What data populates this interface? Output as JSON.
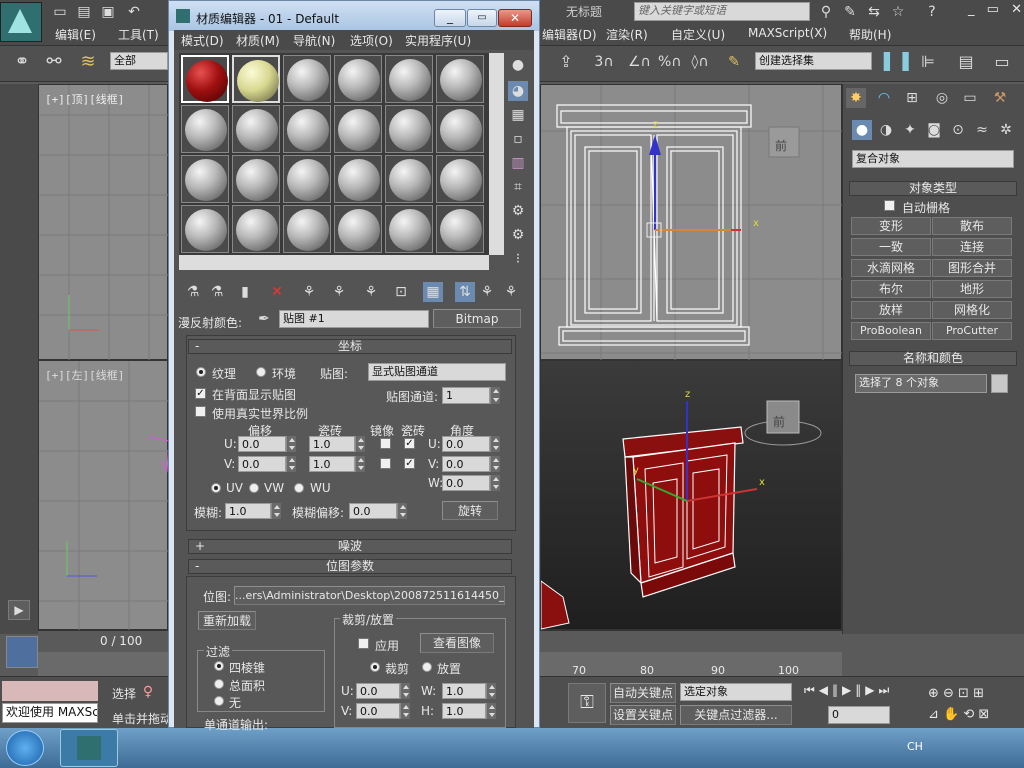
{
  "max_menu": [
    "编辑(E)",
    "工具(T)"
  ],
  "max_menu_right": [
    "编辑器(D)",
    "渲染(R)",
    "自定义(U)",
    "MAXScript(X)",
    "帮助(H)"
  ],
  "max_title": "无标题",
  "search_placeholder": "键入关键字或短语",
  "toolbar": {
    "all_label": "全部",
    "selection_set": "创建选择集"
  },
  "viewports": {
    "top": "[+][顶][线框]",
    "left": "[+][左][线框]",
    "front_cube": "前",
    "persp_cube": "前",
    "axis_x": "x",
    "axis_y": "y",
    "axis_z": "z"
  },
  "command_panel": {
    "dropdown": "复合对象",
    "object_type_header": "对象类型",
    "auto_grid": "自动栅格",
    "buttons": [
      "变形",
      "散布",
      "一致",
      "连接",
      "水滴网格",
      "图形合并",
      "布尔",
      "地形",
      "放样",
      "网格化",
      "ProBoolean",
      "ProCutter"
    ],
    "name_color_header": "名称和颜色",
    "name_value": "选择了 8 个对象"
  },
  "mat_editor": {
    "title": "材质编辑器 - 01 - Default",
    "menu": [
      "模式(D)",
      "材质(M)",
      "导航(N)",
      "选项(O)",
      "实用程序(U)"
    ],
    "diffuse_label": "漫反射颜色:",
    "map_name": "贴图 #1",
    "map_type": "Bitmap",
    "coords": {
      "header": "坐标",
      "texture": "纹理",
      "environ": "环境",
      "mapping_label": "贴图:",
      "mapping_value": "显式贴图通道",
      "show_back": "在背面显示贴图",
      "map_channel_label": "贴图通道:",
      "map_channel": "1",
      "real_world": "使用真实世界比例",
      "offset": "偏移",
      "tiling": "瓷砖",
      "mirror": "镜像",
      "tile": "瓷砖",
      "angle": "角度",
      "u": "U:",
      "v": "V:",
      "w": "W:",
      "u_offset": "0.0",
      "v_offset": "0.0",
      "u_tiling": "1.0",
      "v_tiling": "1.0",
      "u_angle": "0.0",
      "v_angle": "0.0",
      "w_angle": "0.0",
      "uv": "UV",
      "vw": "VW",
      "wu": "WU",
      "blur_label": "模糊:",
      "blur": "1.0",
      "blur_offset_label": "模糊偏移:",
      "blur_offset": "0.0",
      "rotate": "旋转"
    },
    "noise_header": "噪波",
    "bitmap_header": "位图参数",
    "bitmap_label": "位图:",
    "bitmap_path": "...ers\\Administrator\\Desktop\\200872511614450_2.jpg",
    "reload": "重新加载",
    "crop_header": "裁剪/放置",
    "apply": "应用",
    "view_image": "查看图像",
    "crop": "裁剪",
    "place": "放置",
    "cu": "U:",
    "cv": "V:",
    "cw": "W:",
    "ch": "H:",
    "cu_val": "0.0",
    "cv_val": "0.0",
    "cw_val": "1.0",
    "ch_val": "1.0",
    "filter_header": "过滤",
    "pyramidal": "四棱锥",
    "summed": "总面积",
    "none": "无",
    "mono_output": "单通道输出:"
  },
  "timeline": {
    "frame": "0 / 100",
    "ticks_right": [
      "70",
      "80",
      "90",
      "100"
    ]
  },
  "status": {
    "welcome": "欢迎使用 MAXSc",
    "select_label": "选择",
    "click_drag": "单击并拖动",
    "auto_key": "自动关键点",
    "set_key": "设置关键点",
    "selected_obj": "选定对象",
    "key_filter": "关键点过滤器...",
    "frame_value": "0"
  },
  "taskbar": {
    "lang": "CH"
  }
}
